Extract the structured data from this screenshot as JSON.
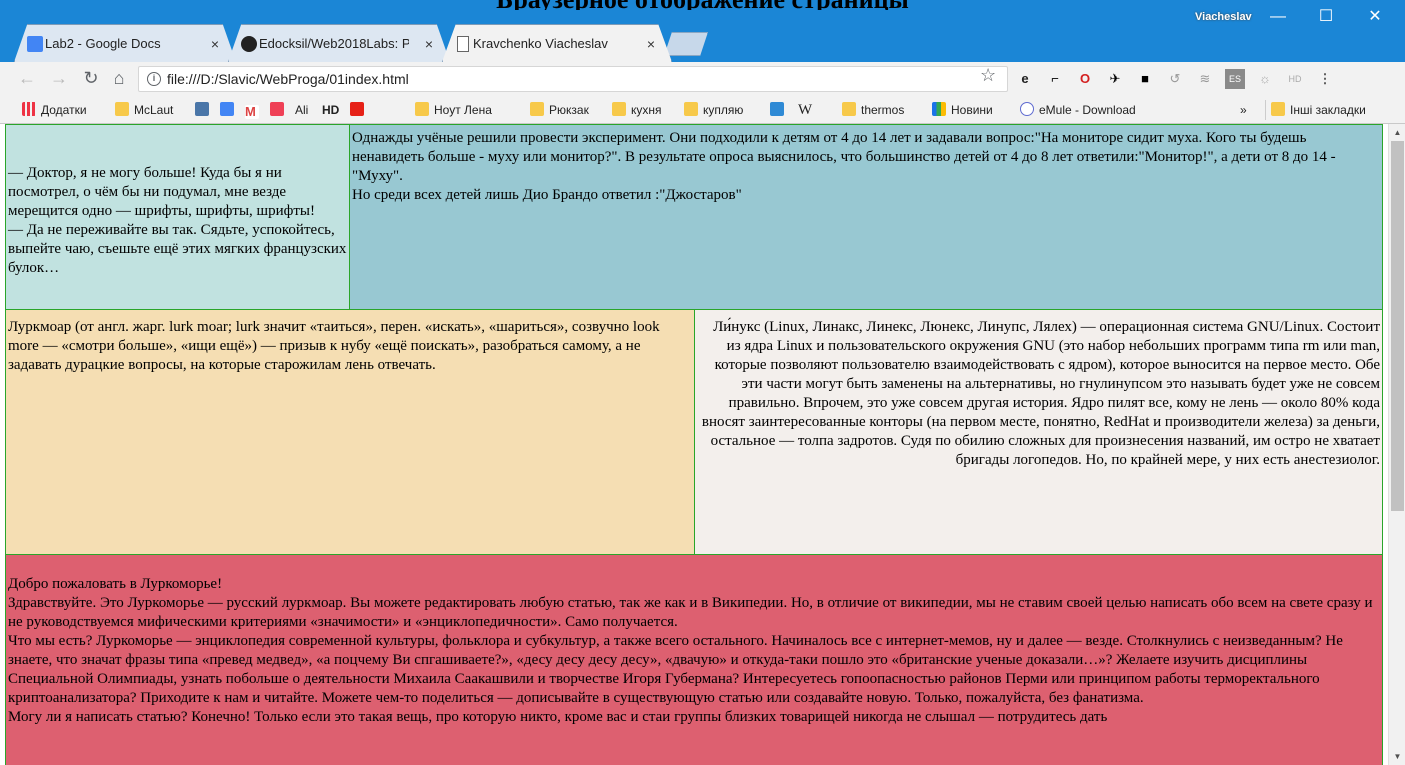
{
  "browser": {
    "tabs": [
      {
        "title": "Lab2 - Google Docs",
        "icon": "google-docs-icon"
      },
      {
        "title": "Edocksil/Web2018Labs: P",
        "icon": "github-icon"
      },
      {
        "title": "Kravchenko Viacheslav",
        "icon": "page-icon"
      }
    ],
    "profile_name": "Viacheslav",
    "url": "file:///D:/Slavic/WebProga/01index.html",
    "bookmarks": [
      {
        "label": "Додатки",
        "icon": "apps-icon"
      },
      {
        "label": "McLaut",
        "icon": "folder-icon"
      },
      {
        "label": "",
        "icon": "vk-icon"
      },
      {
        "label": "",
        "icon": "translate-icon"
      },
      {
        "label": "",
        "icon": "gmail-icon"
      },
      {
        "label": "",
        "icon": "pocket-icon"
      },
      {
        "label": "Ali",
        "icon": "ali-icon"
      },
      {
        "label": "HD",
        "icon": "hd-icon"
      },
      {
        "label": "",
        "icon": "youtube-icon"
      },
      {
        "label": "Ноут Лена",
        "icon": "folder-icon"
      },
      {
        "label": "Рюкзак",
        "icon": "folder-icon"
      },
      {
        "label": "кухня",
        "icon": "folder-icon"
      },
      {
        "label": "купляю",
        "icon": "folder-icon"
      },
      {
        "label": "",
        "icon": "kaggle-icon"
      },
      {
        "label": "",
        "icon": "wikipedia-icon"
      },
      {
        "label": "thermos",
        "icon": "folder-icon"
      },
      {
        "label": "Новини",
        "icon": "news-icon"
      },
      {
        "label": "eMule - Download",
        "icon": "emule-icon"
      }
    ],
    "bookmarks_more": "»",
    "other_bookmarks": "Інші закладки"
  },
  "page": {
    "overlay_title": "Браузерное отображение страницы",
    "cell1": {
      "line1": "— Доктор, я не могу больше! Куда бы я ни посмотрел, о чём бы ни подумал, мне везде мерещится одно — шрифты, шрифты, шрифты!",
      "line2": "— Да не переживайте вы так. Сядьте, успокойтесь, выпейте чаю, съешьте ещё этих мягких французских булок…"
    },
    "cell2": {
      "line1": "Однажды учёные решили провести эксперимент. Они подходили к детям от 4 до 14 лет и задавали вопрос:\"На мониторе сидит муха. Кого ты будешь ненавидеть больше - муху или монитор?\". В результате опроса выяснилось, что большинство детей от 4 до 8 лет ответили:\"Монитор!\", а дети от 8 до 14 - \"Муху\".",
      "line2": "Но среди всех детей лишь Дио Брандо ответил :\"Джостаров\""
    },
    "cell3": "Луркмоар (от англ. жарг. lurk moar; lurk значит «таиться», перен. «искать», «шариться», созвучно look more — «смотри больше», «ищи ещё») — призыв к нубу «ещё поискать», разобраться самому, а не задавать дурацкие вопросы, на которые старожилам лень отвечать.",
    "cell4": "Ли́нукс (Linux, Линакс, Линекс, Люнекс, Линупс, Лялех) — операционная система GNU/Linux. Состоит из ядра Linux и пользовательского окружения GNU (это набор небольших программ типа rm или man, которые позволяют пользователю взаимодействовать с ядром), которое выносится на первое место. Обе эти части могут быть заменены на альтернативы, но гнулинупсом это называть будет уже не совсем правильно. Впрочем, это уже совсем другая история. Ядро пилят все, кому не лень — около 80% кода вносят заинтересованные конторы (на первом месте, понятно, RedHat и производители железа) за деньги, остальное — толпа задротов. Судя по обилию сложных для произнесения названий, им остро не хватает бригады логопедов. Но, по крайней мере, у них есть анестезиолог.",
    "cell5": {
      "line1": "Добро пожаловать в Луркоморье!",
      "line2": "Здравствуйте. Это Луркоморье — русский луркмоар. Вы можете редактировать любую статью, так же как и в Википедии. Но, в отличие от википедии, мы не ставим своей целью написать обо всем на свете сразу и не руководствуемся мифическими критериями «значимости» и «энциклопедичности». Само получается.",
      "line3": "Что мы есть? Луркоморье — энциклопедия современной культуры, фольклора и субкультур, а также всего остального. Начиналось все с интернет-мемов, ну и далее — везде. Столкнулись с неизведанным? Не знаете, что значат фразы типа «превед медвед», «а поцчему Ви спгашиваете?», «десу десу десу десу», «двачую» и откуда-таки пошло это «британские ученые доказали…»? Желаете изучить дисциплины Специальной Олимпиады, узнать побольше о деятельности Михаила Саакашвили и творчестве Игоря Губермана? Интересуетесь гопоопасностью районов Перми или принципом работы терморектального криптоанализатора? Приходите к нам и читайте. Можете чем-то поделиться — дописывайте в существующую статью или создавайте новую. Только, пожалуйста, без фанатизма.",
      "line4": "Могу ли я написать статью? Конечно! Только если это такая вещь, про которую никто, кроме вас и стаи группы близких товарищей никогда не слышал — потрудитесь дать"
    }
  }
}
